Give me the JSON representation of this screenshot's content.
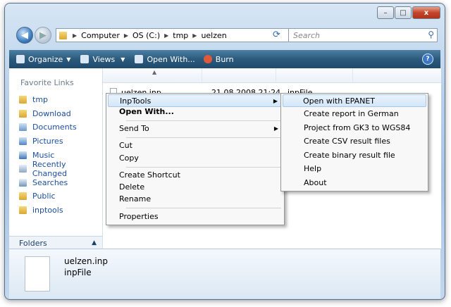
{
  "window": {
    "caption_buttons": {
      "minimize": "–",
      "maximize": "□",
      "close": "x"
    }
  },
  "nav": {
    "back_icon": "arrow-left",
    "forward_icon": "arrow-right"
  },
  "address": {
    "segments": [
      "Computer",
      "OS (C:)",
      "tmp",
      "uelzen"
    ]
  },
  "search": {
    "placeholder": "Search"
  },
  "toolbar": {
    "organize": "Organize",
    "views": "Views",
    "open_with": "Open With...",
    "burn": "Burn",
    "help": "?"
  },
  "sidebar": {
    "header": "Favorite Links",
    "items": [
      "tmp",
      "Download",
      "Documents",
      "Pictures",
      "Music",
      "Recently Changed",
      "Searches",
      "Public",
      "inptools"
    ],
    "folders": "Folders"
  },
  "file": {
    "name": "uelzen.inp",
    "date": "21.08.2008 21:24",
    "type": "inpFile"
  },
  "context_menu": {
    "items": [
      "InpTools",
      "Open With...",
      "Send To",
      "Cut",
      "Copy",
      "Create Shortcut",
      "Delete",
      "Rename",
      "Properties"
    ]
  },
  "submenu": {
    "items": [
      "Open with EPANET",
      "Create report in German",
      "Project from GK3 to WGS84",
      "Create CSV result files",
      "Create binary result file",
      "Help",
      "About"
    ]
  },
  "details": {
    "name": "uelzen.inp",
    "type": "inpFile"
  }
}
